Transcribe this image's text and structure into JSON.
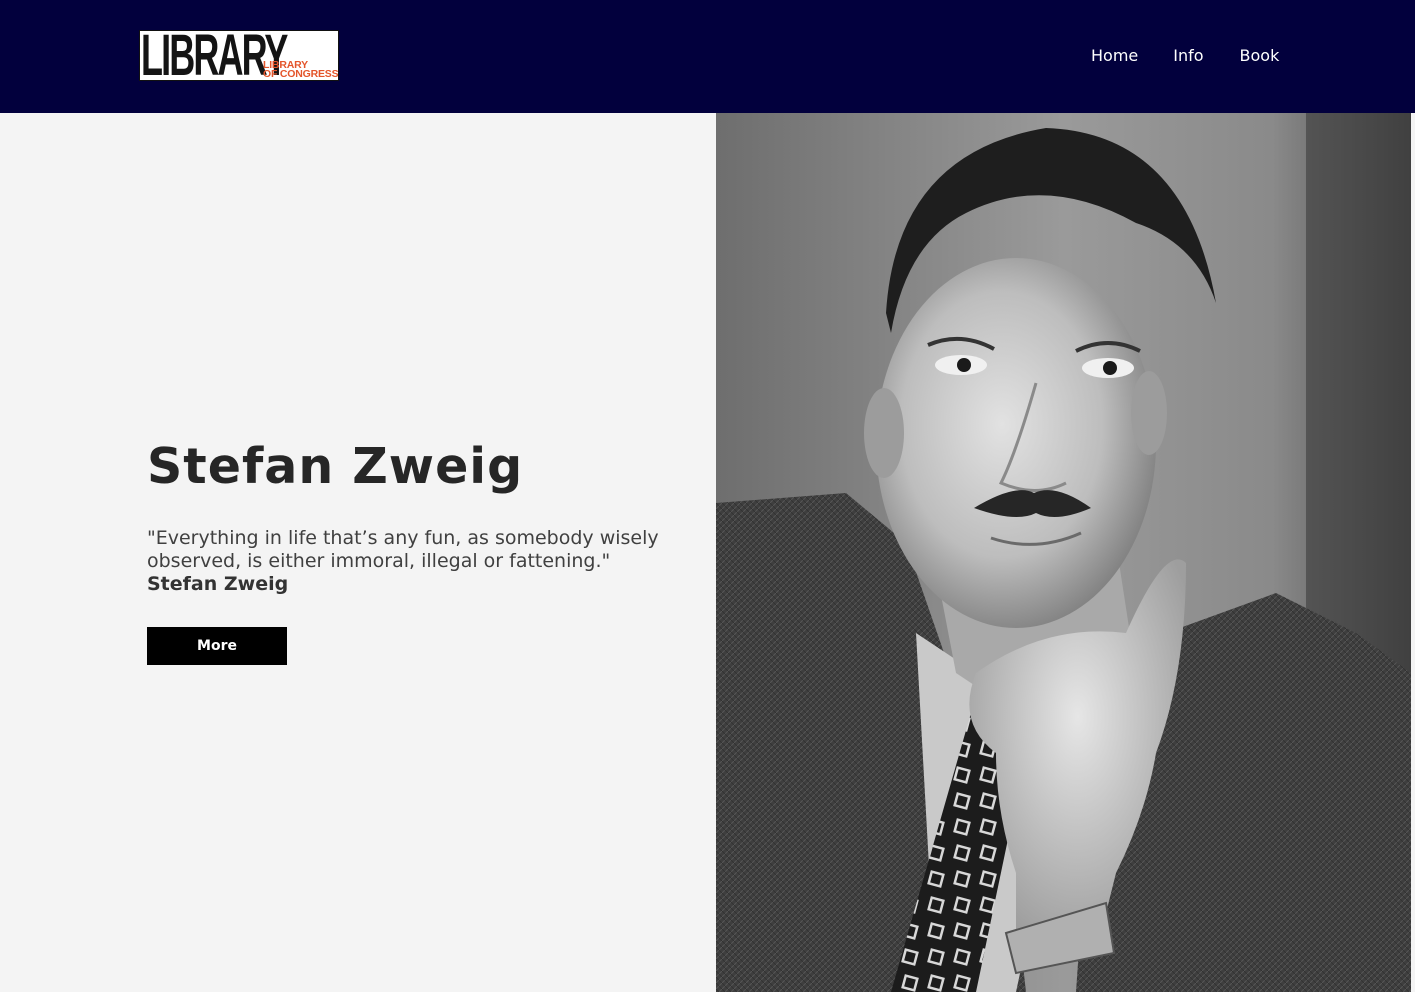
{
  "header": {
    "logo": {
      "main_text": "LIBRARY",
      "sub_text_line1": "LIBRARY",
      "sub_text_line2": "OF CONGRESS"
    },
    "nav": [
      {
        "label": "Home"
      },
      {
        "label": "Info"
      },
      {
        "label": "Book"
      }
    ],
    "background_color": "#02003d"
  },
  "hero": {
    "title": "Stefan Zweig",
    "quote": "\"Everything in life that’s any fun, as somebody wisely observed, is either immoral, illegal or fattening.\"",
    "author": "Stefan Zweig",
    "button_label": "More",
    "portrait_alt": "Black and white photograph of Stefan Zweig"
  },
  "colors": {
    "accent_orange": "#e4552b",
    "button_bg": "#000000",
    "page_bg": "#f4f4f4"
  }
}
